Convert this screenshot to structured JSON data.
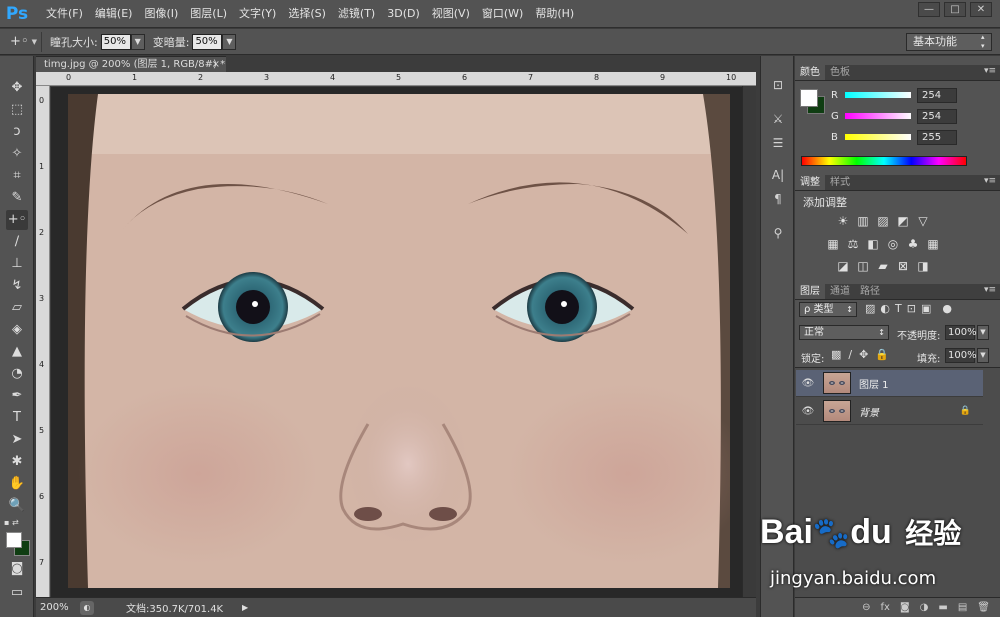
{
  "app": {
    "logo": "Ps"
  },
  "menu": [
    "文件(F)",
    "编辑(E)",
    "图像(I)",
    "图层(L)",
    "文字(Y)",
    "选择(S)",
    "滤镜(T)",
    "3D(D)",
    "视图(V)",
    "窗口(W)",
    "帮助(H)"
  ],
  "window_controls": {
    "minimize": "—",
    "restore": "□",
    "close": "✕"
  },
  "options": {
    "pupil_size_label": "瞳孔大小:",
    "pupil_size_value": "50%",
    "darken_label": "变暗量:",
    "darken_value": "50%",
    "workspace": "基本功能"
  },
  "document": {
    "tab_title": "timg.jpg @ 200% (图层 1, RGB/8#) *",
    "tab_close": "×",
    "ruler_h_ticks": [
      "0",
      "1",
      "2",
      "3",
      "4",
      "5",
      "6",
      "7",
      "8",
      "9",
      "10"
    ],
    "ruler_v_ticks": [
      "0",
      "1",
      "2",
      "3",
      "4",
      "5",
      "6",
      "7"
    ]
  },
  "status": {
    "zoom": "200%",
    "doc_info": "文档:350.7K/701.4K",
    "arrow": "▶"
  },
  "color_panel": {
    "tabs": [
      "颜色",
      "色板"
    ],
    "channels": [
      {
        "label": "R",
        "value": "254",
        "color": "#00e5ff"
      },
      {
        "label": "G",
        "value": "254",
        "color": "#ff00ff"
      },
      {
        "label": "B",
        "value": "255",
        "color": "#ffff00"
      }
    ],
    "foreground": "#fefeff",
    "background": "#0f3d12"
  },
  "adjustments_panel": {
    "tabs": [
      "调整",
      "样式"
    ],
    "title": "添加调整",
    "row1": [
      "☀",
      "▥",
      "▨",
      "◩",
      "▽"
    ],
    "row2": [
      "▦",
      "⚖",
      "◧",
      "◎",
      "♣",
      "▦"
    ],
    "row3": [
      "◪",
      "◫",
      "▰",
      "⊠",
      "◨"
    ]
  },
  "layers_panel": {
    "tabs": [
      "图层",
      "通道",
      "路径"
    ],
    "filter_label": "ρ 类型",
    "blend_mode": "正常",
    "opacity_label": "不透明度:",
    "opacity_value": "100%",
    "lock_label": "锁定:",
    "fill_label": "填充:",
    "fill_value": "100%",
    "layers": [
      {
        "name": "图层 1",
        "selected": true
      },
      {
        "name": "背景",
        "selected": false,
        "locked": true
      }
    ],
    "footer_icons": [
      "⊖",
      "fx",
      "◙",
      "◑",
      "▬",
      "▤",
      "🗑"
    ]
  },
  "watermark": {
    "brand": "Bai",
    "brand2": "du",
    "cn": "经验",
    "url": "jingyan.baidu.com"
  }
}
